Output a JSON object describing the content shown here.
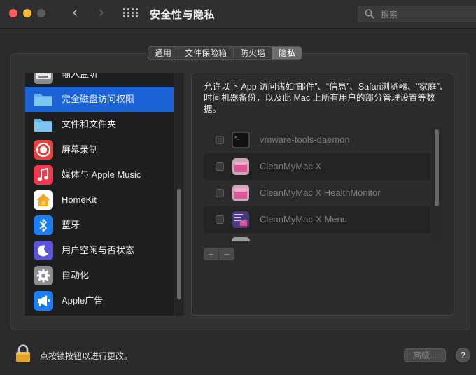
{
  "toolbar": {
    "title": "安全性与隐私",
    "back_glyph": "‹",
    "forward_glyph": "›",
    "search": {
      "placeholder": "搜索",
      "value": ""
    }
  },
  "tabs": [
    {
      "label": "通用",
      "active": false
    },
    {
      "label": "文件保险箱",
      "active": false
    },
    {
      "label": "防火墙",
      "active": false
    },
    {
      "label": "隐私",
      "active": true
    }
  ],
  "sidebar": {
    "items": [
      {
        "label": "输入监听",
        "icon": "keyboard-icon"
      },
      {
        "label": "完全磁盘访问权限",
        "icon": "folder-icon",
        "selected": true
      },
      {
        "label": "文件和文件夹",
        "icon": "folder-icon"
      },
      {
        "label": "屏幕录制",
        "icon": "screen-record-icon"
      },
      {
        "label": "媒体与 Apple Music",
        "icon": "music-note-icon"
      },
      {
        "label": "HomeKit",
        "icon": "home-icon"
      },
      {
        "label": "蓝牙",
        "icon": "bluetooth-icon"
      },
      {
        "label": "用户空闲与否状态",
        "icon": "moon-icon"
      },
      {
        "label": "自动化",
        "icon": "gear-icon"
      },
      {
        "label": "Apple广告",
        "icon": "megaphone-icon"
      }
    ]
  },
  "main": {
    "description": "允许以下 App 访问诸如“邮件”、“信息”、Safari浏览器、“家庭”、时间机器备份，以及此 Mac 上所有用户的部分管理设置等数据。",
    "apps": [
      {
        "name": "vmware-tools-daemon",
        "checked": false,
        "icon": "terminal-icon"
      },
      {
        "name": "CleanMyMac X",
        "checked": false,
        "icon": "cleanmymac-icon"
      },
      {
        "name": "CleanMyMac X HealthMonitor",
        "checked": false,
        "icon": "cleanmymac-icon"
      },
      {
        "name": "CleanMyMac-X Menu",
        "checked": false,
        "icon": "cleanmymac-menu-icon"
      },
      {
        "name": "",
        "checked": false,
        "icon": "app-icon"
      }
    ],
    "add_label": "+",
    "remove_label": "−"
  },
  "footer": {
    "lock_text": "点按锁按钮以进行更改。",
    "advanced_label": "高级...",
    "help_label": "?"
  },
  "colors": {
    "selection": "#1a62d6",
    "window_bg": "#2a2a2c",
    "close": "#fe5f57",
    "minimize": "#febc2e",
    "lock": "#e2a52a"
  }
}
